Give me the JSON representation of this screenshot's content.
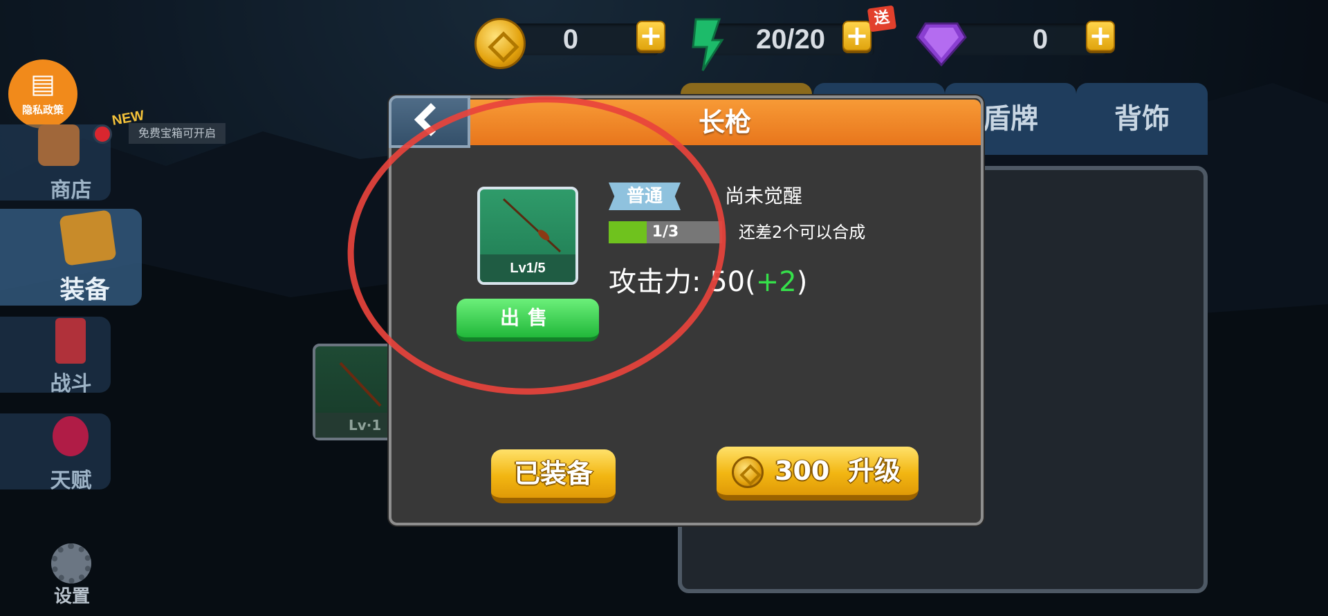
{
  "resources": {
    "gold": {
      "value": "0",
      "plus": "+"
    },
    "energy": {
      "value": "20/20",
      "plus": "+",
      "gift_tag": "送"
    },
    "gems": {
      "value": "0",
      "plus": "+"
    }
  },
  "privacy_badge": {
    "label": "隐私政策",
    "icon": "document-shield-icon"
  },
  "side_menu": {
    "shop": {
      "label": "商店",
      "new_tag": "NEW",
      "notice": "免费宝箱可开启"
    },
    "equipment": {
      "label": "装备"
    },
    "battle": {
      "label": "战斗"
    },
    "talent": {
      "label": "天赋"
    },
    "settings": {
      "label": "设置"
    }
  },
  "right_panel": {
    "tabs": [
      {
        "label": ""
      },
      {
        "label": ""
      },
      {
        "label": "盾牌"
      },
      {
        "label": "背饰"
      }
    ]
  },
  "inventory_item": {
    "level": "Lv·1"
  },
  "dialog": {
    "title": "长枪",
    "item_level": "Lv1/5",
    "sell_label": "出售",
    "rarity": "普通",
    "awaken_status": "尚未觉醒",
    "progress": {
      "text": "1/3",
      "fraction": 0.333
    },
    "need_text": "还差2个可以合成",
    "attack_label": "攻击力:",
    "attack_value": "50",
    "attack_bonus_open": "(",
    "attack_bonus": "+2",
    "attack_bonus_close": ")",
    "equipped_label": "已装备",
    "upgrade_cost": "300",
    "upgrade_label": "升级"
  },
  "colors": {
    "header_orange": "#f08a2a",
    "sell_green": "#2ec447",
    "gold_button": "#f2b612",
    "annotation_red": "#e8433c",
    "bonus_green": "#35e04a"
  }
}
